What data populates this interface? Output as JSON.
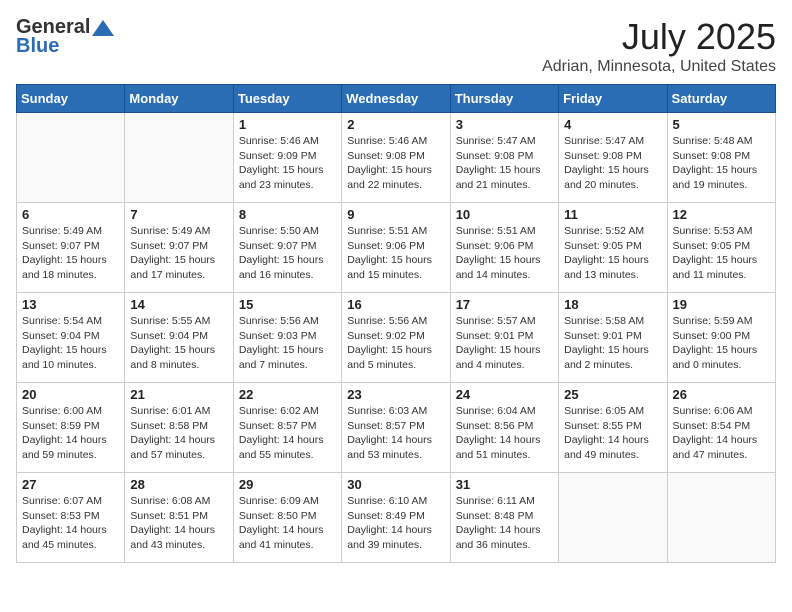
{
  "header": {
    "logo_general": "General",
    "logo_blue": "Blue",
    "month": "July 2025",
    "location": "Adrian, Minnesota, United States"
  },
  "days_of_week": [
    "Sunday",
    "Monday",
    "Tuesday",
    "Wednesday",
    "Thursday",
    "Friday",
    "Saturday"
  ],
  "weeks": [
    [
      {
        "day": "",
        "info": ""
      },
      {
        "day": "",
        "info": ""
      },
      {
        "day": "1",
        "info": "Sunrise: 5:46 AM\nSunset: 9:09 PM\nDaylight: 15 hours\nand 23 minutes."
      },
      {
        "day": "2",
        "info": "Sunrise: 5:46 AM\nSunset: 9:08 PM\nDaylight: 15 hours\nand 22 minutes."
      },
      {
        "day": "3",
        "info": "Sunrise: 5:47 AM\nSunset: 9:08 PM\nDaylight: 15 hours\nand 21 minutes."
      },
      {
        "day": "4",
        "info": "Sunrise: 5:47 AM\nSunset: 9:08 PM\nDaylight: 15 hours\nand 20 minutes."
      },
      {
        "day": "5",
        "info": "Sunrise: 5:48 AM\nSunset: 9:08 PM\nDaylight: 15 hours\nand 19 minutes."
      }
    ],
    [
      {
        "day": "6",
        "info": "Sunrise: 5:49 AM\nSunset: 9:07 PM\nDaylight: 15 hours\nand 18 minutes."
      },
      {
        "day": "7",
        "info": "Sunrise: 5:49 AM\nSunset: 9:07 PM\nDaylight: 15 hours\nand 17 minutes."
      },
      {
        "day": "8",
        "info": "Sunrise: 5:50 AM\nSunset: 9:07 PM\nDaylight: 15 hours\nand 16 minutes."
      },
      {
        "day": "9",
        "info": "Sunrise: 5:51 AM\nSunset: 9:06 PM\nDaylight: 15 hours\nand 15 minutes."
      },
      {
        "day": "10",
        "info": "Sunrise: 5:51 AM\nSunset: 9:06 PM\nDaylight: 15 hours\nand 14 minutes."
      },
      {
        "day": "11",
        "info": "Sunrise: 5:52 AM\nSunset: 9:05 PM\nDaylight: 15 hours\nand 13 minutes."
      },
      {
        "day": "12",
        "info": "Sunrise: 5:53 AM\nSunset: 9:05 PM\nDaylight: 15 hours\nand 11 minutes."
      }
    ],
    [
      {
        "day": "13",
        "info": "Sunrise: 5:54 AM\nSunset: 9:04 PM\nDaylight: 15 hours\nand 10 minutes."
      },
      {
        "day": "14",
        "info": "Sunrise: 5:55 AM\nSunset: 9:04 PM\nDaylight: 15 hours\nand 8 minutes."
      },
      {
        "day": "15",
        "info": "Sunrise: 5:56 AM\nSunset: 9:03 PM\nDaylight: 15 hours\nand 7 minutes."
      },
      {
        "day": "16",
        "info": "Sunrise: 5:56 AM\nSunset: 9:02 PM\nDaylight: 15 hours\nand 5 minutes."
      },
      {
        "day": "17",
        "info": "Sunrise: 5:57 AM\nSunset: 9:01 PM\nDaylight: 15 hours\nand 4 minutes."
      },
      {
        "day": "18",
        "info": "Sunrise: 5:58 AM\nSunset: 9:01 PM\nDaylight: 15 hours\nand 2 minutes."
      },
      {
        "day": "19",
        "info": "Sunrise: 5:59 AM\nSunset: 9:00 PM\nDaylight: 15 hours\nand 0 minutes."
      }
    ],
    [
      {
        "day": "20",
        "info": "Sunrise: 6:00 AM\nSunset: 8:59 PM\nDaylight: 14 hours\nand 59 minutes."
      },
      {
        "day": "21",
        "info": "Sunrise: 6:01 AM\nSunset: 8:58 PM\nDaylight: 14 hours\nand 57 minutes."
      },
      {
        "day": "22",
        "info": "Sunrise: 6:02 AM\nSunset: 8:57 PM\nDaylight: 14 hours\nand 55 minutes."
      },
      {
        "day": "23",
        "info": "Sunrise: 6:03 AM\nSunset: 8:57 PM\nDaylight: 14 hours\nand 53 minutes."
      },
      {
        "day": "24",
        "info": "Sunrise: 6:04 AM\nSunset: 8:56 PM\nDaylight: 14 hours\nand 51 minutes."
      },
      {
        "day": "25",
        "info": "Sunrise: 6:05 AM\nSunset: 8:55 PM\nDaylight: 14 hours\nand 49 minutes."
      },
      {
        "day": "26",
        "info": "Sunrise: 6:06 AM\nSunset: 8:54 PM\nDaylight: 14 hours\nand 47 minutes."
      }
    ],
    [
      {
        "day": "27",
        "info": "Sunrise: 6:07 AM\nSunset: 8:53 PM\nDaylight: 14 hours\nand 45 minutes."
      },
      {
        "day": "28",
        "info": "Sunrise: 6:08 AM\nSunset: 8:51 PM\nDaylight: 14 hours\nand 43 minutes."
      },
      {
        "day": "29",
        "info": "Sunrise: 6:09 AM\nSunset: 8:50 PM\nDaylight: 14 hours\nand 41 minutes."
      },
      {
        "day": "30",
        "info": "Sunrise: 6:10 AM\nSunset: 8:49 PM\nDaylight: 14 hours\nand 39 minutes."
      },
      {
        "day": "31",
        "info": "Sunrise: 6:11 AM\nSunset: 8:48 PM\nDaylight: 14 hours\nand 36 minutes."
      },
      {
        "day": "",
        "info": ""
      },
      {
        "day": "",
        "info": ""
      }
    ]
  ]
}
